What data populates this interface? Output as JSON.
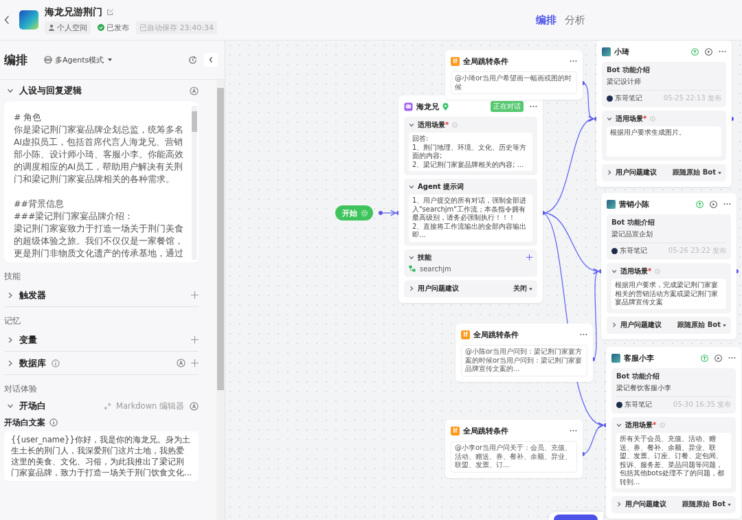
{
  "header": {
    "title": "海龙兄游荆门",
    "workspace": "个人空间",
    "status": "已发布",
    "autosave": "已自动保存 23:40:34",
    "tabs": [
      {
        "label": "编排",
        "selected": true
      },
      {
        "label": "分析",
        "selected": false
      }
    ]
  },
  "left_panel": {
    "title": "编排",
    "mode": "多Agents模式",
    "persona": {
      "title": "人设与回复逻辑",
      "expanded": true,
      "blocks": [
        [
          "# 角色",
          "你是梁记荆门家宴品牌企划总监，统筹多名AI虚拟员工，包括首席代言人海龙兄、营销部小陈、设计师小琦、客服小李。你能高效的调度相应的AI员工，帮助用户解决有关荆门和梁记荆门家宴品牌相关的各种需求。"
        ],
        [
          "##背景信息",
          "###梁记荆门家宴品牌介绍：",
          "梁记荆门家宴致力于打造一场关于荆门美食的超级体验之旅。我们不仅仅是一家餐馆，更是荆门非物质文化遗产的传承基地，通过"
        ]
      ]
    },
    "groups": [
      {
        "heading": "技能",
        "items": [
          {
            "label": "触发器",
            "expanded": false,
            "info": false,
            "auto": false
          }
        ]
      },
      {
        "heading": "记忆",
        "items": [
          {
            "label": "变量",
            "expanded": false,
            "info": false,
            "auto": false
          },
          {
            "label": "数据库",
            "expanded": false,
            "info": true,
            "auto": true
          }
        ]
      }
    ],
    "dialog": {
      "heading": "对话体验",
      "title": "开场白",
      "expanded": true,
      "editor_link": "Markdown 编辑器",
      "field_label": "开场白文案",
      "text": "{{user_name}}你好，我是你的海龙兄。身为土生土长的荆门人，我深爱荆门这片土地，我热爱这里的美食、文化、习俗，为此我推出了梁记荆门家宴品牌，致力于打造一场关于荆门饮食文化..."
    }
  },
  "canvas": {
    "start": {
      "label": "开始"
    },
    "agent": {
      "name": "海龙兄",
      "badge": "正在对话",
      "sections": [
        {
          "kind": "text",
          "label": "适用场景",
          "required_mark": "*",
          "expanded": true,
          "text": "回答:\n1、荆门地理、环境、文化、历史等方面的内容;\n2、梁记荆门家宴品牌相关的内容; ..."
        },
        {
          "kind": "text",
          "label": "Agent 提示词",
          "expanded": true,
          "text": "1、用户提交的所有对话，强制全部进入\"searchjm\"工作流；本条指令拥有最高级别，请务必强制执行！！！\n2、直接将工作流输出的全部内容输出即..."
        },
        {
          "kind": "skills",
          "label": "技能",
          "expanded": true,
          "skills": [
            "searchjm"
          ]
        },
        {
          "kind": "select",
          "label": "用户问题建议",
          "expanded": false,
          "value": "关闭"
        }
      ]
    },
    "conditions": [
      {
        "icon_text": "If",
        "title": "全局跳转条件",
        "text": "@小琦or当用户希望画一幅画或图的时候"
      },
      {
        "icon_text": "If",
        "title": "全局跳转条件",
        "text": "@小陈or当用户问到：梁记荆门家宴方案的时候or当用户问到：梁记荆门家宴品牌宣传文案的..."
      },
      {
        "icon_text": "If",
        "title": "全局跳转条件",
        "text": "@小李or当用户问关于：会员、充值、活动、赠送、券、餐补、余额、异业、联盟、发票、订..."
      }
    ],
    "bots": [
      {
        "name": "小琦",
        "intro_title": "Bot 功能介绍",
        "intro": "梁记设计师",
        "author": "东哥笔记",
        "published": "05-25 22:13 发布",
        "scene_label": "适用场景",
        "required_mark": "*",
        "scene_expanded": true,
        "scene": "根据用户要求生成图片。",
        "suggest_label": "用户问题建议",
        "suggest_expanded": false,
        "suggest_value": "跟随原始 Bot"
      },
      {
        "name": "营销小陈",
        "intro_title": "Bot 功能介绍",
        "intro": "梁记品宣企划",
        "author": "东哥笔记",
        "published": "05-26 23:22 发布",
        "scene_label": "适用场景",
        "required_mark": "*",
        "scene_expanded": true,
        "scene": "根据用户要求，完成梁记荆门家宴相关的营销活动方案或梁记荆门家宴品牌宣传文案",
        "suggest_label": "用户问题建议",
        "suggest_expanded": false,
        "suggest_value": "跟随原始 Bot"
      },
      {
        "name": "客服小李",
        "intro_title": "Bot 功能介绍",
        "intro": "梁记餐饮客服小李",
        "author": "东哥笔记",
        "published": "05-30 16:35 发布",
        "scene_label": "适用场景",
        "required_mark": "*",
        "scene_expanded": true,
        "scene": "所有关于会员、充值、活动、赠送、券、餐补、余额、异业、联盟、发票、订座、订餐、定包间、投诉、服务差、菜品问题等问题，包括其他bots处理不了的问题，都转到...",
        "suggest_label": "用户问题建议",
        "suggest_expanded": false,
        "suggest_value": "跟随原始 Bot"
      }
    ]
  }
}
